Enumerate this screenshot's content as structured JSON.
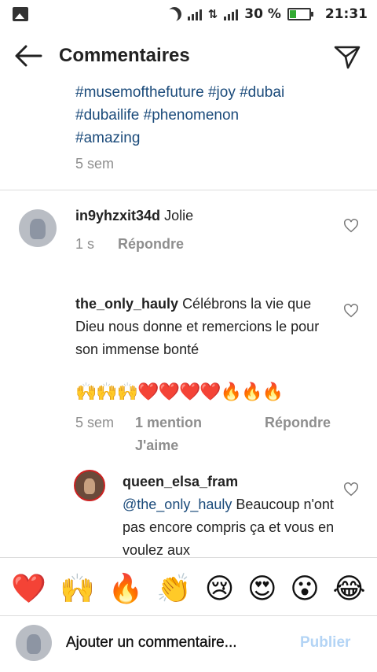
{
  "status_bar": {
    "battery_percent": "30 %",
    "time": "21:31",
    "battery_level": 0.3,
    "icons": [
      "image-icon",
      "moon-icon",
      "signal-icon",
      "data-transfer-icon",
      "signal-icon-2",
      "battery-icon"
    ]
  },
  "header": {
    "title": "Commentaires",
    "back_icon": "arrow-left-icon",
    "share_icon": "send-icon"
  },
  "caption": {
    "hashtags_line1": "#musemofthefuture #joy #dubai",
    "hashtags_line2": "#dubailife #phenomenon",
    "hashtags_line3": "#amazing",
    "time": "5 sem",
    "hashtag_color": "#1a4a7a"
  },
  "comments": [
    {
      "username": "in9yhzxit34d",
      "text": "Jolie",
      "time": "1 s",
      "reply": "Répondre"
    },
    {
      "username": "the_only_hauly",
      "text": "Célébrons la vie que Dieu nous donne et remercions le pour son immense bonté",
      "emoji": "🙌🙌🙌❤️❤️❤️❤️🔥🔥🔥",
      "time": "5 sem",
      "likes": "1 mention J'aime",
      "reply": "Répondre"
    },
    {
      "username": "queen_elsa_fram",
      "mention": "@the_only_hauly",
      "text": "Beaucoup n'ont pas encore compris ça et vous en voulez aux"
    }
  ],
  "reactions": [
    "❤️",
    "🙌",
    "🔥",
    "👏",
    "😢",
    "😍",
    "😮",
    "😂"
  ],
  "composer": {
    "placeholder": "Ajouter un commentaire...",
    "publish": "Publier",
    "publish_color": "#b3d4f5"
  }
}
